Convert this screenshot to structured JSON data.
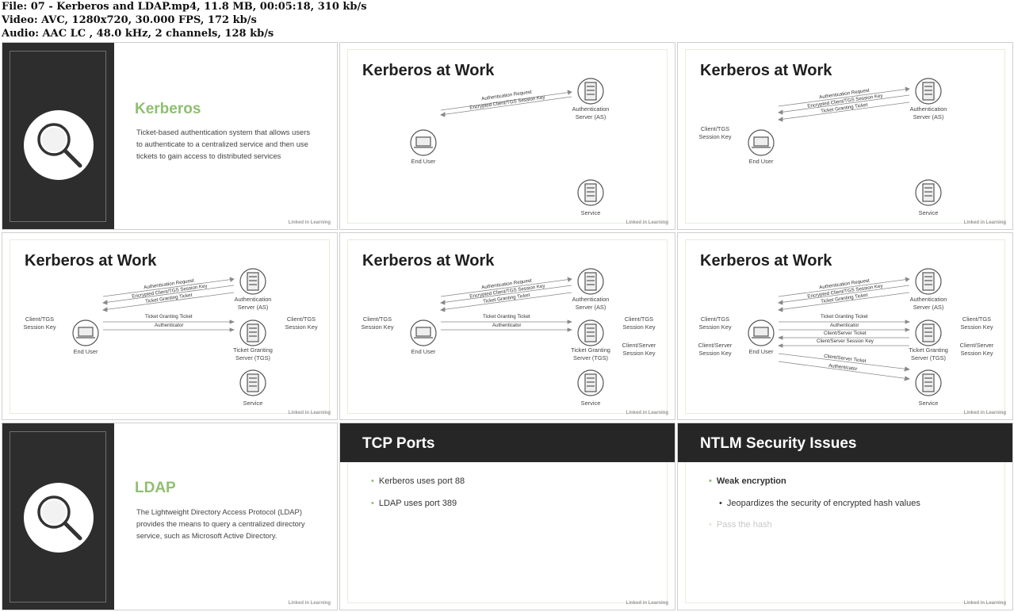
{
  "header": {
    "file": "File: 07 - Kerberos and LDAP.mp4, 11.8 MB, 00:05:18, 310 kb/s",
    "video": "Video: AVC, 1280x720, 30.000 FPS, 172 kb/s",
    "audio": "Audio: AAC LC , 48.0 kHz, 2 channels, 128 kb/s"
  },
  "watermark": "Linked in Learning",
  "tile1": {
    "title": "Kerberos",
    "body": "Ticket-based authentication system that allows users to authenticate to a centralized service and then use tickets to gain access to distributed services",
    "icon": "magnifying-glass-icon"
  },
  "diagram_title": "Kerberos at Work",
  "labels": {
    "end_user": "End User",
    "auth_server_1": "Authentication",
    "auth_server_2": "Server (AS)",
    "service": "Service",
    "tgs_1": "Ticket Granting",
    "tgs_2": "Server (TGS)",
    "client_tgs_1": "Client/TGS",
    "client_tgs_2": "Session Key",
    "client_server_1": "Client/Server",
    "client_server_2": "Session Key"
  },
  "messages": {
    "auth_request": "Authentication Request",
    "enc_client_tgs": "Encrypted Client/TGS Session Key",
    "tgt": "Ticket Granting Ticket",
    "authenticator": "Authenticator",
    "client_server_ticket": "Client/Server Ticket",
    "client_server_key": "Client/Server Session Key"
  },
  "tile7": {
    "title": "LDAP",
    "body": "The Lightweight Directory Access Protocol (LDAP) provides the means to query a centralized directory service, such as Microsoft Active Directory.",
    "icon": "magnifying-glass-icon"
  },
  "tile8": {
    "title": "TCP Ports",
    "bullets": [
      "Kerberos uses port 88",
      "LDAP uses port 389"
    ]
  },
  "tile9": {
    "title": "NTLM Security Issues",
    "bullet1": "Weak encryption",
    "sub1": "Jeopardizes the security of encrypted hash values",
    "bullet2": "Pass the hash"
  },
  "colors": {
    "accent": "#8fbf6f",
    "dark": "#2d2d2d",
    "bar": "#262626"
  }
}
